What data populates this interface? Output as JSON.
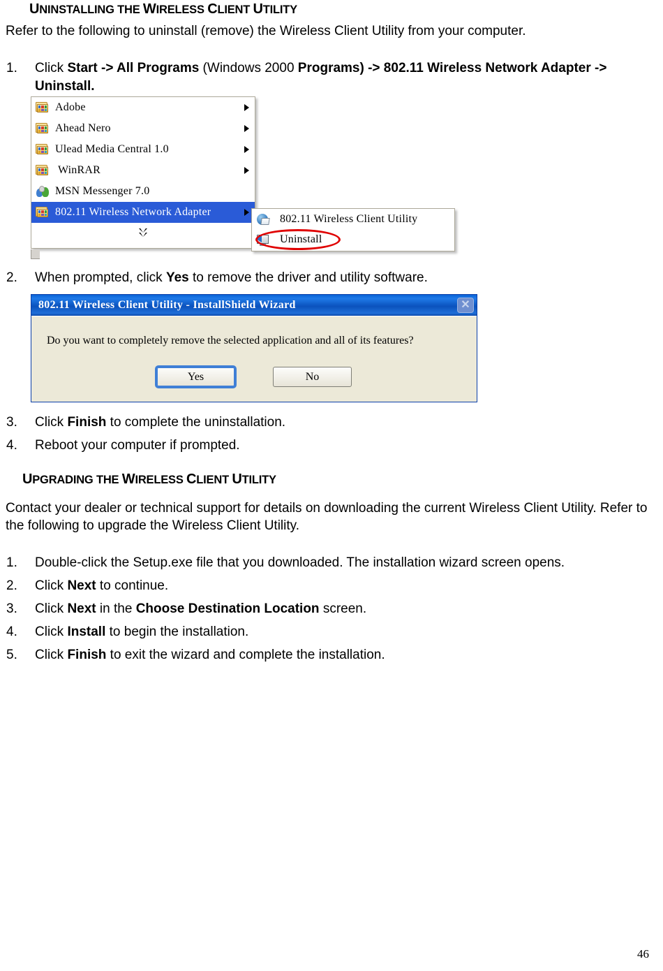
{
  "document": {
    "page_number": "46"
  },
  "sections": {
    "uninstalling": {
      "heading": {
        "parts": [
          {
            "t": "U",
            "cap": true
          },
          {
            "t": "NINSTALLING THE ",
            "cap": false
          },
          {
            "t": "W",
            "cap": true
          },
          {
            "t": "IRELESS ",
            "cap": false
          },
          {
            "t": "C",
            "cap": true
          },
          {
            "t": "LIENT ",
            "cap": false
          },
          {
            "t": "U",
            "cap": true
          },
          {
            "t": "TILITY",
            "cap": false
          }
        ],
        "plain": "UNINSTALLING THE WIRELESS CLIENT UTILITY"
      },
      "intro": "Refer to the following to uninstall (remove) the Wireless Client Utility from your computer.",
      "steps": [
        {
          "num": "1.",
          "runs": [
            {
              "text": "Click ",
              "bold": false
            },
            {
              "text": "Start -> All Programs",
              "bold": true
            },
            {
              "text": " (Windows 2000 ",
              "bold": false
            },
            {
              "text": "Programs) -> 802.11 Wireless Network Adapter -> Uninstall.",
              "bold": true
            }
          ]
        },
        {
          "num": "2.",
          "runs": [
            {
              "text": "When prompted, click ",
              "bold": false
            },
            {
              "text": "Yes",
              "bold": true
            },
            {
              "text": " to remove the driver and utility software.",
              "bold": false
            }
          ]
        },
        {
          "num": "3.",
          "runs": [
            {
              "text": "Click ",
              "bold": false
            },
            {
              "text": "Finish",
              "bold": true
            },
            {
              "text": " to complete the uninstallation.",
              "bold": false
            }
          ]
        },
        {
          "num": "4.",
          "runs": [
            {
              "text": "Reboot your computer if prompted.",
              "bold": false
            }
          ]
        }
      ]
    },
    "upgrading": {
      "heading": {
        "parts": [
          {
            "t": "U",
            "cap": true
          },
          {
            "t": "PGRADING THE ",
            "cap": false
          },
          {
            "t": "W",
            "cap": true
          },
          {
            "t": "IRELESS ",
            "cap": false
          },
          {
            "t": "C",
            "cap": true
          },
          {
            "t": "LIENT ",
            "cap": false
          },
          {
            "t": "U",
            "cap": true
          },
          {
            "t": "TILITY",
            "cap": false
          }
        ],
        "plain": "UPGRADING THE WIRELESS CLIENT UTILITY"
      },
      "intro": "Contact your dealer or technical support for details on downloading the current Wireless Client Utility. Refer to the following to upgrade the Wireless Client Utility.",
      "steps": [
        {
          "num": "1.",
          "runs": [
            {
              "text": "Double-click the Setup.exe file that you downloaded. The installation wizard screen opens.",
              "bold": false
            }
          ]
        },
        {
          "num": "2.",
          "runs": [
            {
              "text": "Click ",
              "bold": false
            },
            {
              "text": "Next",
              "bold": true
            },
            {
              "text": " to continue.",
              "bold": false
            }
          ]
        },
        {
          "num": "3.",
          "runs": [
            {
              "text": "Click ",
              "bold": false
            },
            {
              "text": "Next",
              "bold": true
            },
            {
              "text": " in the ",
              "bold": false
            },
            {
              "text": "Choose Destination Location",
              "bold": true
            },
            {
              "text": " screen.",
              "bold": false
            }
          ]
        },
        {
          "num": "4.",
          "runs": [
            {
              "text": "Click ",
              "bold": false
            },
            {
              "text": "Install",
              "bold": true
            },
            {
              "text": " to begin the installation.",
              "bold": false
            }
          ]
        },
        {
          "num": "5.",
          "runs": [
            {
              "text": "Click ",
              "bold": false
            },
            {
              "text": "Finish",
              "bold": true
            },
            {
              "text": " to exit the wizard and complete the installation.",
              "bold": false
            }
          ]
        }
      ]
    }
  },
  "screenshot_start_menu": {
    "items": [
      {
        "label": "Adobe",
        "icon": "folder-icon",
        "arrow": true,
        "selected": false
      },
      {
        "label": "Ahead Nero",
        "icon": "folder-icon",
        "arrow": true,
        "selected": false
      },
      {
        "label": "Ulead Media Central 1.0",
        "icon": "folder-icon",
        "arrow": true,
        "selected": false
      },
      {
        "label": "WinRAR",
        "icon": "folder-icon",
        "arrow": true,
        "selected": false
      },
      {
        "label": "MSN Messenger 7.0",
        "icon": "msn-messenger-icon",
        "arrow": false,
        "selected": false
      },
      {
        "label": "802.11 Wireless Network Adapter",
        "icon": "folder-icon",
        "arrow": true,
        "selected": true
      }
    ],
    "expander_icon": "double-chevron-down-icon",
    "submenu": {
      "items": [
        {
          "label": "802.11 Wireless Client Utility",
          "icon": "wireless-client-utility-icon",
          "annotated": false
        },
        {
          "label": "Uninstall",
          "icon": "uninstall-icon",
          "annotated": true
        }
      ],
      "annotation_color": "#e00000"
    },
    "highlight_color": "#2a5bd7"
  },
  "screenshot_dialog": {
    "title": "802.11 Wireless Client Utility - InstallShield Wizard",
    "close_icon": "close-icon",
    "message": "Do you want to completely remove the selected application and all of its features?",
    "buttons": [
      {
        "label": "Yes",
        "default": true
      },
      {
        "label": "No",
        "default": false
      }
    ],
    "titlebar_color": "#0b52bd",
    "body_color": "#ece9d8"
  }
}
